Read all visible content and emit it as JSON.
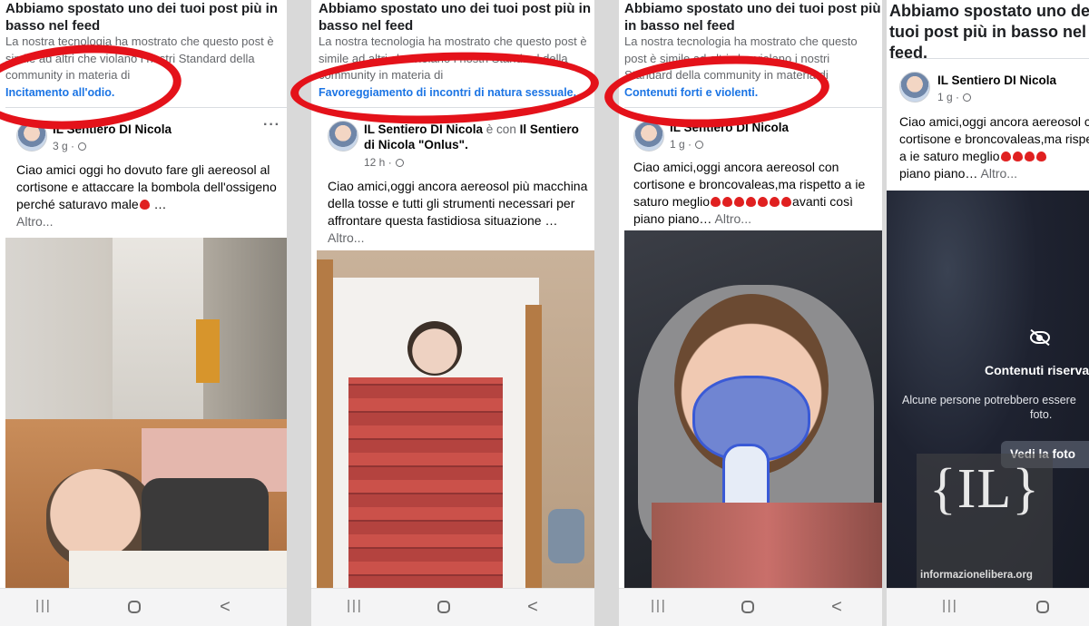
{
  "panels": [
    {
      "notice_title": "Abbiamo spostato uno dei tuoi post più in basso nel feed",
      "notice_body": "La nostra tecnologia ha mostrato che questo post è simile ad altri che violano i nostri Standard della community in materia di",
      "category": "Incitamento all'odio.",
      "author": "IL Sentiero DI Nicola",
      "time": "3 g ·",
      "more": "···",
      "post_text": "Ciao amici oggi ho dovuto fare gli aereosol al cortisone e attaccare la bombola dell'ossigeno perché saturavo male",
      "ellipsis": " …",
      "altro": "Altro..."
    },
    {
      "notice_title": "Abbiamo spostato uno dei tuoi post più in basso nel feed",
      "notice_body": "La nostra tecnologia ha mostrato che questo post è simile ad altri che violano i nostri Standard della community in materia di",
      "category": "Favoreggiamento di incontri di natura sessuale.",
      "author": "IL Sentiero DI Nicola",
      "author_with": " è con ",
      "author2": "Il Sentiero di Nicola \"Onlus\".",
      "time": "12 h ·",
      "post_text": "Ciao amici,oggi ancora aereosol più macchina della tosse e tutti gli strumenti necessari per affrontare questa fastidiosa situazione …",
      "altro": " Altro..."
    },
    {
      "notice_title": "Abbiamo spostato uno dei tuoi post più in basso nel feed",
      "notice_body": "La nostra tecnologia ha mostrato che questo post è simile ad altri che violano i nostri Standard della community in materia di",
      "category": "Contenuti forti e violenti.",
      "author": "IL Sentiero DI Nicola",
      "time": "1 g ·",
      "post_text_1": "Ciao amici,oggi ancora aereosol con cortisone e broncovaleas,ma rispetto a ie saturo meglio",
      "post_text_2": "avanti così piano piano…",
      "altro": " Altro..."
    },
    {
      "big_title": "Abbiamo spostato uno dei tuoi post più in basso nel feed.",
      "author": "IL Sentiero DI Nicola",
      "time": "1 g ·",
      "post_text": "Ciao amici,oggi ancora aereosol con cortisone e broncovaleas,ma rispetto a ie saturo meglio",
      "post_text_2": "piano piano…",
      "altro": " Altro...",
      "sensitive_title": "Contenuti riservati",
      "sensitive_desc": "Alcune persone potrebbero essere",
      "sensitive_desc2": "foto.",
      "view_button": "Vedi la foto"
    }
  ],
  "nav": {
    "recent": "|||",
    "home": "",
    "back": "<"
  },
  "watermark": {
    "logo": "{IL}",
    "site": "informazionelibera.org"
  },
  "colors": {
    "annotation_red": "#e4121a",
    "link_blue": "#1b74e4",
    "heart_red": "#e02020"
  }
}
